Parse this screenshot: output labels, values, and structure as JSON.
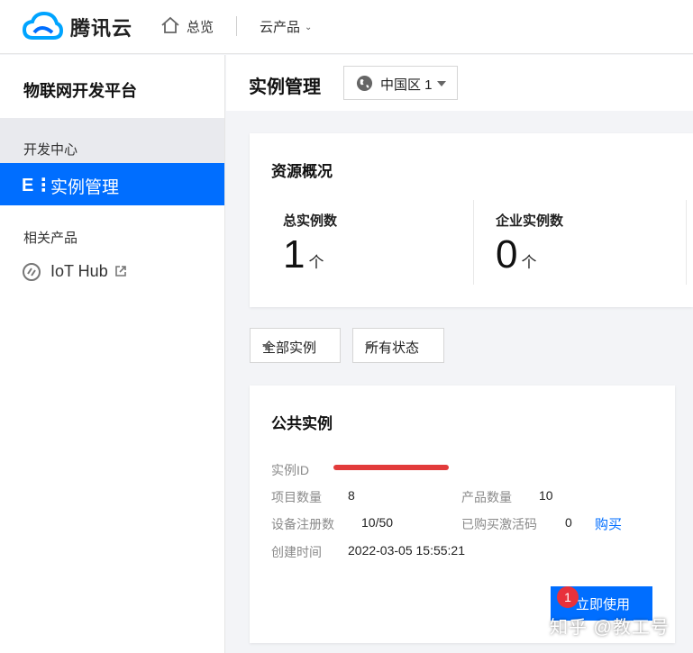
{
  "topbar": {
    "brand": "腾讯云",
    "overview": "总览",
    "products": "云产品",
    "products_chevron": "⌄"
  },
  "sidebar": {
    "platform_title": "物联网开发平台",
    "section_dev": "开发中心",
    "active_item": {
      "icon": "E⋮",
      "label": "实例管理"
    },
    "section_related": "相关产品",
    "related_item": "IoT Hub"
  },
  "header": {
    "title": "实例管理",
    "region": "中国区 1"
  },
  "overview": {
    "title": "资源概况",
    "stats": [
      {
        "label": "总实例数",
        "value": "1",
        "unit": "个"
      },
      {
        "label": "企业实例数",
        "value": "0",
        "unit": "个"
      }
    ]
  },
  "filters": {
    "all_instances": "全部实例",
    "all_status": "所有状态"
  },
  "instance": {
    "title": "公共实例",
    "id_label": "实例ID",
    "projects_label": "项目数量",
    "projects_value": "8",
    "products_label": "产品数量",
    "products_value": "10",
    "devices_label": "设备注册数",
    "devices_value": "10/50",
    "codes_label": "已购买激活码",
    "codes_value": "0",
    "buy_label": "购买",
    "created_label": "创建时间",
    "created_value": "2022-03-05 15:55:21",
    "use_button": "立即使用",
    "step_badge": "1"
  },
  "watermark": "知乎 @教工号",
  "colors": {
    "primary": "#006eff",
    "badge": "#e8313b",
    "redaction": "#e23b3b"
  }
}
